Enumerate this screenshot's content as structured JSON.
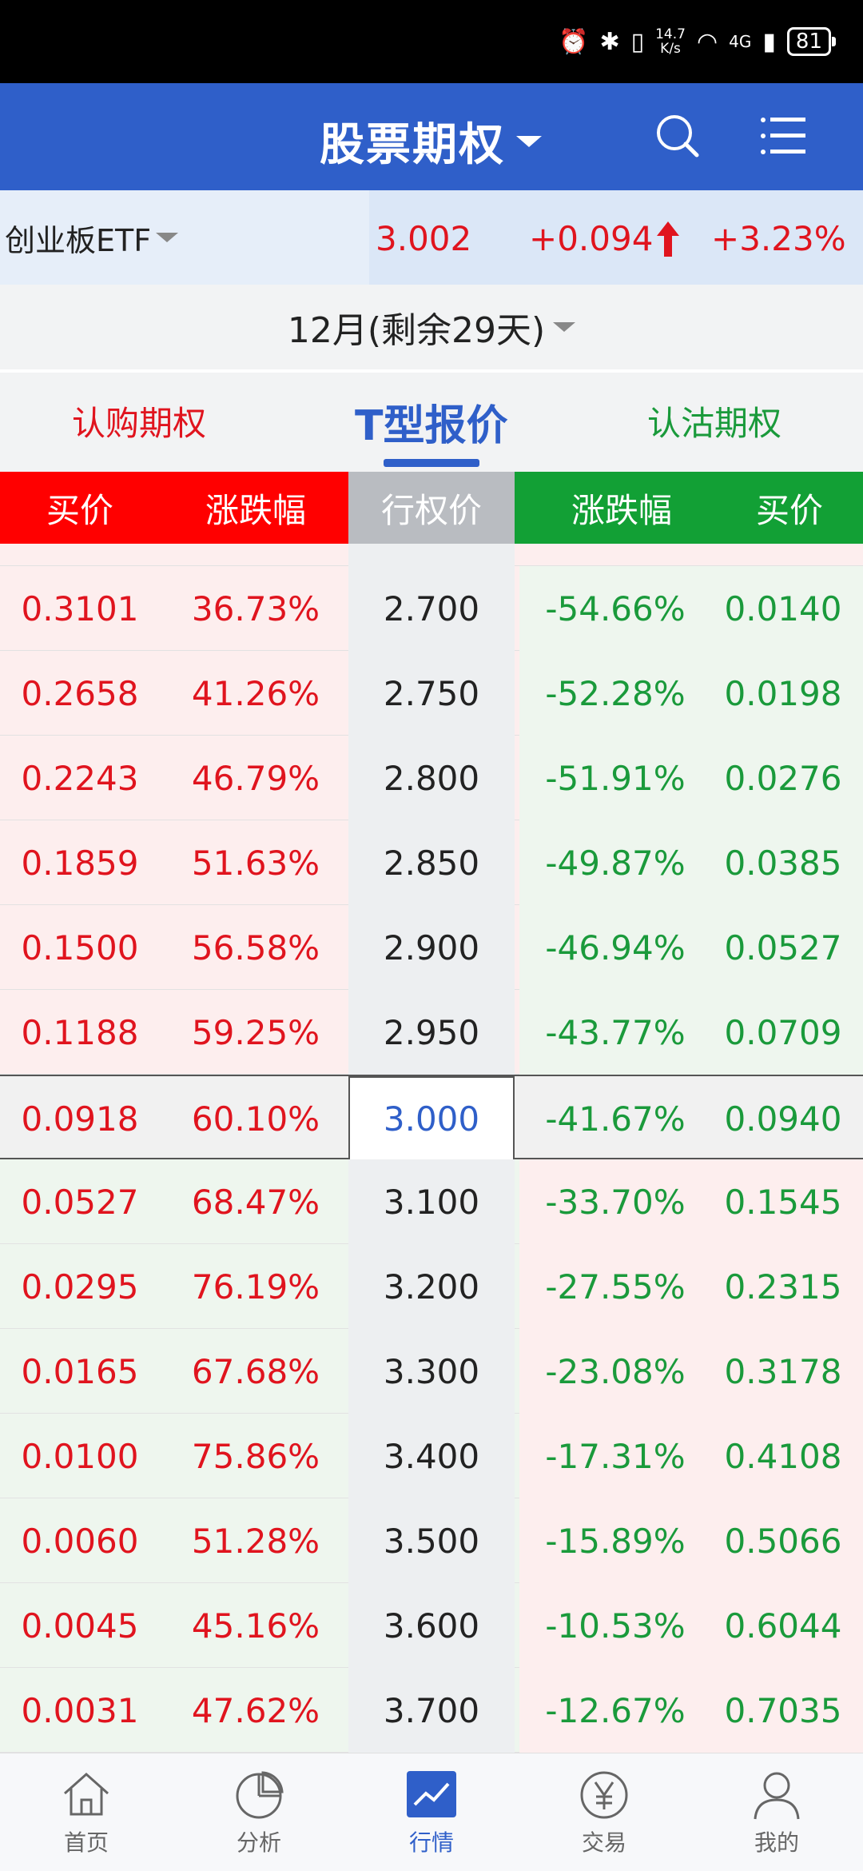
{
  "status": {
    "speed_top": "14.7",
    "speed_bottom": "K/s",
    "network": "4G",
    "battery": "81"
  },
  "header": {
    "title": "股票期权",
    "search_icon": "search-icon",
    "menu_icon": "list-icon"
  },
  "underlying": {
    "name": "创业板ETF",
    "price": "3.002",
    "change": "+0.094",
    "change_pct": "+3.23%"
  },
  "expiry": {
    "label": "12月(剩余29天)"
  },
  "tabs": [
    {
      "label": "认购期权"
    },
    {
      "label": "T型报价"
    },
    {
      "label": "认沽期权"
    }
  ],
  "columns": {
    "call_bid": "买价",
    "call_chg": "涨跌幅",
    "strike": "行权价",
    "put_chg": "涨跌幅",
    "put_bid": "买价"
  },
  "rows": [
    {
      "cb": "0.3101",
      "cc": "36.73%",
      "k": "2.700",
      "pc": "-54.66%",
      "pb": "0.0140"
    },
    {
      "cb": "0.2658",
      "cc": "41.26%",
      "k": "2.750",
      "pc": "-52.28%",
      "pb": "0.0198"
    },
    {
      "cb": "0.2243",
      "cc": "46.79%",
      "k": "2.800",
      "pc": "-51.91%",
      "pb": "0.0276"
    },
    {
      "cb": "0.1859",
      "cc": "51.63%",
      "k": "2.850",
      "pc": "-49.87%",
      "pb": "0.0385"
    },
    {
      "cb": "0.1500",
      "cc": "56.58%",
      "k": "2.900",
      "pc": "-46.94%",
      "pb": "0.0527"
    },
    {
      "cb": "0.1188",
      "cc": "59.25%",
      "k": "2.950",
      "pc": "-43.77%",
      "pb": "0.0709"
    },
    {
      "cb": "0.0918",
      "cc": "60.10%",
      "k": "3.000",
      "pc": "-41.67%",
      "pb": "0.0940"
    },
    {
      "cb": "0.0527",
      "cc": "68.47%",
      "k": "3.100",
      "pc": "-33.70%",
      "pb": "0.1545"
    },
    {
      "cb": "0.0295",
      "cc": "76.19%",
      "k": "3.200",
      "pc": "-27.55%",
      "pb": "0.2315"
    },
    {
      "cb": "0.0165",
      "cc": "67.68%",
      "k": "3.300",
      "pc": "-23.08%",
      "pb": "0.3178"
    },
    {
      "cb": "0.0100",
      "cc": "75.86%",
      "k": "3.400",
      "pc": "-17.31%",
      "pb": "0.4108"
    },
    {
      "cb": "0.0060",
      "cc": "51.28%",
      "k": "3.500",
      "pc": "-15.89%",
      "pb": "0.5066"
    },
    {
      "cb": "0.0045",
      "cc": "45.16%",
      "k": "3.600",
      "pc": "-10.53%",
      "pb": "0.6044"
    },
    {
      "cb": "0.0031",
      "cc": "47.62%",
      "k": "3.700",
      "pc": "-12.67%",
      "pb": "0.7035"
    }
  ],
  "nav": [
    {
      "label": "首页",
      "icon": "home-icon"
    },
    {
      "label": "分析",
      "icon": "pie-chart-icon"
    },
    {
      "label": "行情",
      "icon": "trend-chart-icon"
    },
    {
      "label": "交易",
      "icon": "yen-icon"
    },
    {
      "label": "我的",
      "icon": "user-icon"
    }
  ],
  "colors": {
    "brand": "#2f5fc9",
    "up": "#e0141e",
    "down": "#1a9a3b"
  }
}
